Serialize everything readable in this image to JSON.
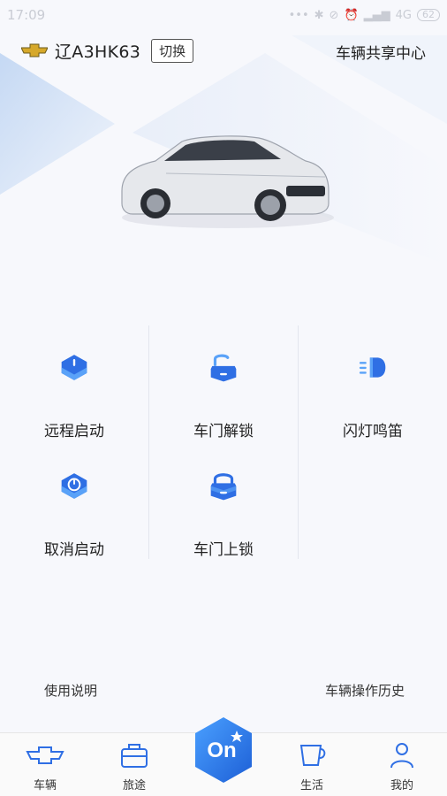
{
  "status_bar": {
    "time": "17:09",
    "network": "4G",
    "battery": "62"
  },
  "header": {
    "plate": "辽A3HK63",
    "switch_label": "切换",
    "share_center": "车辆共享中心"
  },
  "controls": [
    {
      "label": "远程启动",
      "icon": "remote-start-icon"
    },
    {
      "label": "车门解锁",
      "icon": "unlock-icon"
    },
    {
      "label": "闪灯鸣笛",
      "icon": "headlight-horn-icon"
    },
    {
      "label": "取消启动",
      "icon": "cancel-start-icon"
    },
    {
      "label": "车门上锁",
      "icon": "lock-icon"
    }
  ],
  "links": {
    "manual": "使用说明",
    "history": "车辆操作历史"
  },
  "tabbar": {
    "tabs": [
      {
        "label": "车辆",
        "icon": "chevrolet-icon"
      },
      {
        "label": "旅途",
        "icon": "suitcase-icon"
      },
      {
        "label": "生活",
        "icon": "cup-icon"
      },
      {
        "label": "我的",
        "icon": "person-icon"
      }
    ],
    "center_label": "On"
  },
  "colors": {
    "accent": "#2f6fe4",
    "accent_light": "#5aa2f8",
    "brand_gold": "#d6a82a"
  }
}
